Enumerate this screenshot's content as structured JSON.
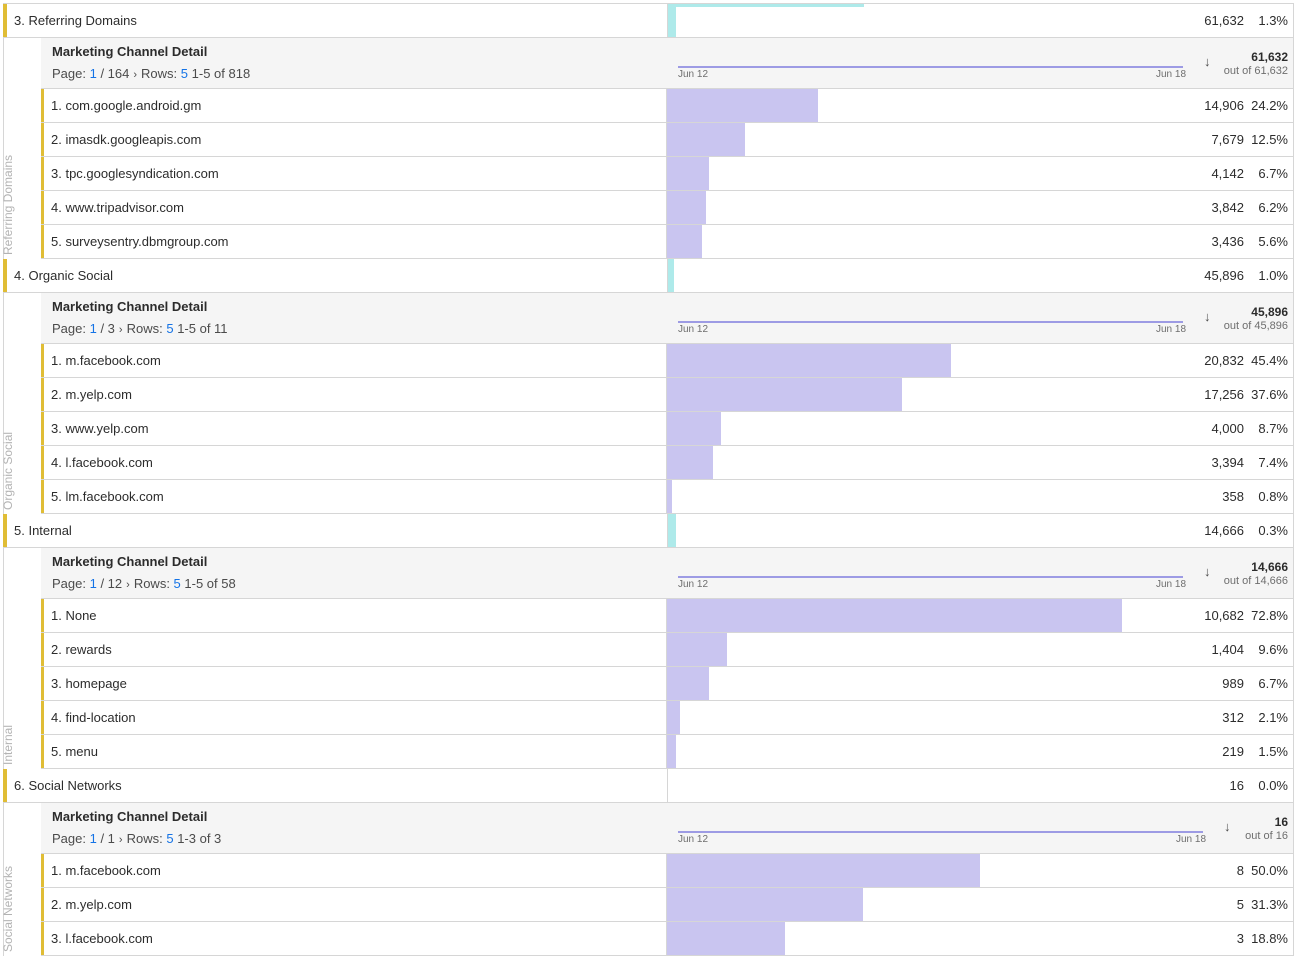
{
  "columns": {
    "header_title": "Marketing Channel Detail",
    "date_start": "Jun 12",
    "date_end": "Jun 18",
    "sort_icon": "arrow-down-icon"
  },
  "colors": {
    "accent": "#e0bd35",
    "top_bar": "#aeeaea",
    "sub_bar": "#c9c5f0",
    "link": "#1473e6"
  },
  "groups": [
    {
      "label": "3.  Referring Domains",
      "vlabel": "Referring Domains",
      "metric": "61,632",
      "pct": "1.3%",
      "bar_pct": 0.3,
      "pager": {
        "prefix": "Page:",
        "page": "1",
        "pages": "/ 164",
        "rows_label": "Rows:",
        "rows": "5",
        "range": "1-5 of 818"
      },
      "total": "61,632",
      "outof": "out of 61,632",
      "rows": [
        {
          "label": "1.  com.google.android.gm",
          "metric": "14,906",
          "pct": "24.2%",
          "bar_pct": 24.2
        },
        {
          "label": "2.  imasdk.googleapis.com",
          "metric": "7,679",
          "pct": "12.5%",
          "bar_pct": 12.5
        },
        {
          "label": "3.  tpc.googlesyndication.com",
          "metric": "4,142",
          "pct": "6.7%",
          "bar_pct": 6.7
        },
        {
          "label": "4.  www.tripadvisor.com",
          "metric": "3,842",
          "pct": "6.2%",
          "bar_pct": 6.2
        },
        {
          "label": "5.  surveysentry.dbmgroup.com",
          "metric": "3,436",
          "pct": "5.6%",
          "bar_pct": 5.6
        }
      ]
    },
    {
      "label": "4.  Organic Social",
      "vlabel": "Organic Social",
      "metric": "45,896",
      "pct": "1.0%",
      "bar_pct": 1.0,
      "pager": {
        "prefix": "Page:",
        "page": "1",
        "pages": "/ 3",
        "rows_label": "Rows:",
        "rows": "5",
        "range": "1-5 of 11"
      },
      "total": "45,896",
      "outof": "out of 45,896",
      "rows": [
        {
          "label": "1.  m.facebook.com",
          "metric": "20,832",
          "pct": "45.4%",
          "bar_pct": 45.4
        },
        {
          "label": "2.  m.yelp.com",
          "metric": "17,256",
          "pct": "37.6%",
          "bar_pct": 37.6
        },
        {
          "label": "3.  www.yelp.com",
          "metric": "4,000",
          "pct": "8.7%",
          "bar_pct": 8.7
        },
        {
          "label": "4.  l.facebook.com",
          "metric": "3,394",
          "pct": "7.4%",
          "bar_pct": 7.4
        },
        {
          "label": "5.  lm.facebook.com",
          "metric": "358",
          "pct": "0.8%",
          "bar_pct": 0.8
        }
      ]
    },
    {
      "label": "5.  Internal",
      "vlabel": "Internal",
      "metric": "14,666",
      "pct": "0.3%",
      "bar_pct": 0.3,
      "pager": {
        "prefix": "Page:",
        "page": "1",
        "pages": "/ 12",
        "rows_label": "Rows:",
        "rows": "5",
        "range": "1-5 of 58"
      },
      "total": "14,666",
      "outof": "out of 14,666",
      "rows": [
        {
          "label": "1.  None",
          "metric": "10,682",
          "pct": "72.8%",
          "bar_pct": 72.8
        },
        {
          "label": "2.  rewards",
          "metric": "1,404",
          "pct": "9.6%",
          "bar_pct": 9.6
        },
        {
          "label": "3.  homepage",
          "metric": "989",
          "pct": "6.7%",
          "bar_pct": 6.7
        },
        {
          "label": "4.  find-location",
          "metric": "312",
          "pct": "2.1%",
          "bar_pct": 2.1
        },
        {
          "label": "5.  menu",
          "metric": "219",
          "pct": "1.5%",
          "bar_pct": 1.5
        }
      ]
    },
    {
      "label": "6.  Social Networks",
      "vlabel": "Social Networks",
      "metric": "16",
      "pct": "0.0%",
      "bar_pct": 0,
      "pager": {
        "prefix": "Page:",
        "page": "1",
        "pages": "/ 1",
        "rows_label": "Rows:",
        "rows": "5",
        "range": "1-3 of 3"
      },
      "total": "16",
      "outof": "out of 16",
      "rows": [
        {
          "label": "1.  m.facebook.com",
          "metric": "8",
          "pct": "50.0%",
          "bar_pct": 50.0
        },
        {
          "label": "2.  m.yelp.com",
          "metric": "5",
          "pct": "31.3%",
          "bar_pct": 31.3
        },
        {
          "label": "3.  l.facebook.com",
          "metric": "3",
          "pct": "18.8%",
          "bar_pct": 18.8
        }
      ]
    }
  ]
}
